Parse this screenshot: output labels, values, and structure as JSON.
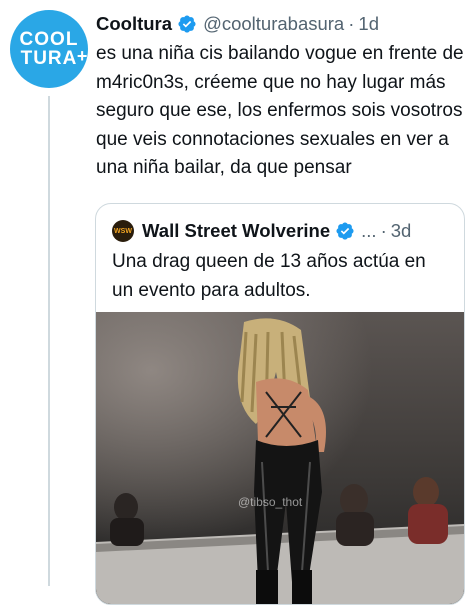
{
  "tweet": {
    "avatar_line1": "COOL",
    "avatar_line2": "TURA",
    "avatar_plus": "+",
    "author_name": "Cooltura",
    "author_handle": "@coolturabasura",
    "separator": "·",
    "timestamp": "1d",
    "text": "es una niña cis bailando vogue en frente de m4ric0n3s, créeme que no hay lugar más seguro que ese, los enfermos sois vosotros que veis connotaciones sexuales en ver a una niña bailar, da que pensar",
    "verified_icon": "verified-badge-icon"
  },
  "quoted_tweet": {
    "avatar_text": "WSW",
    "author_name": "Wall Street Wolverine",
    "ellipsis": "...",
    "separator": "·",
    "timestamp": "3d",
    "text": "Una drag queen de 13 años actúa en un evento para adultos.",
    "media_watermark": "@tibso_thot",
    "colors": {
      "accent": "#1d9bf0",
      "avatar": "#2aa7e6"
    }
  }
}
